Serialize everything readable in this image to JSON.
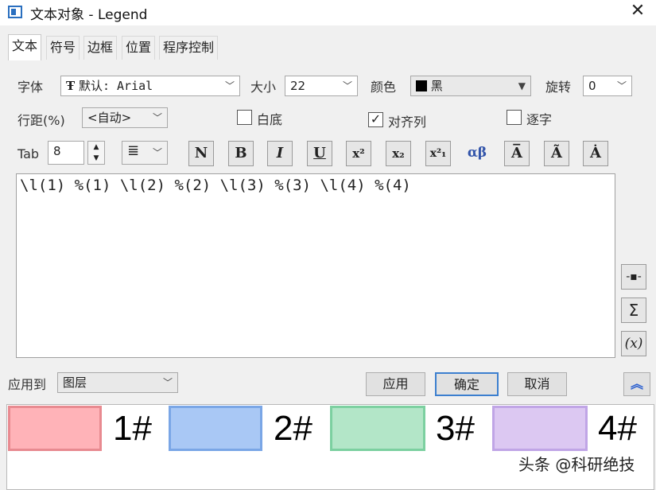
{
  "window": {
    "title": "文本对象 - Legend",
    "close_glyph": "✕"
  },
  "tabs": [
    {
      "label": "文本",
      "active": true
    },
    {
      "label": "符号"
    },
    {
      "label": "边框"
    },
    {
      "label": "位置"
    },
    {
      "label": "程序控制"
    }
  ],
  "font": {
    "label": "字体",
    "value": "默认: Arial"
  },
  "size": {
    "label": "大小",
    "value": "22"
  },
  "color": {
    "label": "颜色",
    "value": "黑",
    "swatch": "#000000"
  },
  "rotate": {
    "label": "旋转",
    "value": "0"
  },
  "line_spacing": {
    "label": "行距(%)",
    "value": "<自动>"
  },
  "white_bg": {
    "label": "白底",
    "checked": false
  },
  "align_columns": {
    "label": "对齐列",
    "checked": true
  },
  "per_char": {
    "label": "逐字",
    "checked": false
  },
  "tab": {
    "label": "Tab",
    "value": "8"
  },
  "format_buttons": [
    "N",
    "B",
    "I",
    "U",
    "x²",
    "x₂",
    "x²₁",
    "αβ",
    "A̅",
    "Ã",
    "Ȧ"
  ],
  "editor": {
    "text": "\\l(1) %(1) \\l(2) %(2) \\l(3) %(3) \\l(4) %(4)"
  },
  "side_buttons": [
    "-▪-",
    "Σ",
    "(x)"
  ],
  "apply_to": {
    "label": "应用到",
    "value": "图层"
  },
  "buttons": {
    "apply": "应用",
    "ok": "确定",
    "cancel": "取消",
    "collapse": "︽"
  },
  "legend": [
    {
      "label": "1#",
      "fill": "#ffb3b8",
      "border": "#e88a90"
    },
    {
      "label": "2#",
      "fill": "#a9c8f5",
      "border": "#7aa6e6"
    },
    {
      "label": "3#",
      "fill": "#b3e6c8",
      "border": "#7cd0a0"
    },
    {
      "label": "4#",
      "fill": "#dcc8f2",
      "border": "#c0a5e6"
    }
  ],
  "watermark": "头条 @科研绝技"
}
